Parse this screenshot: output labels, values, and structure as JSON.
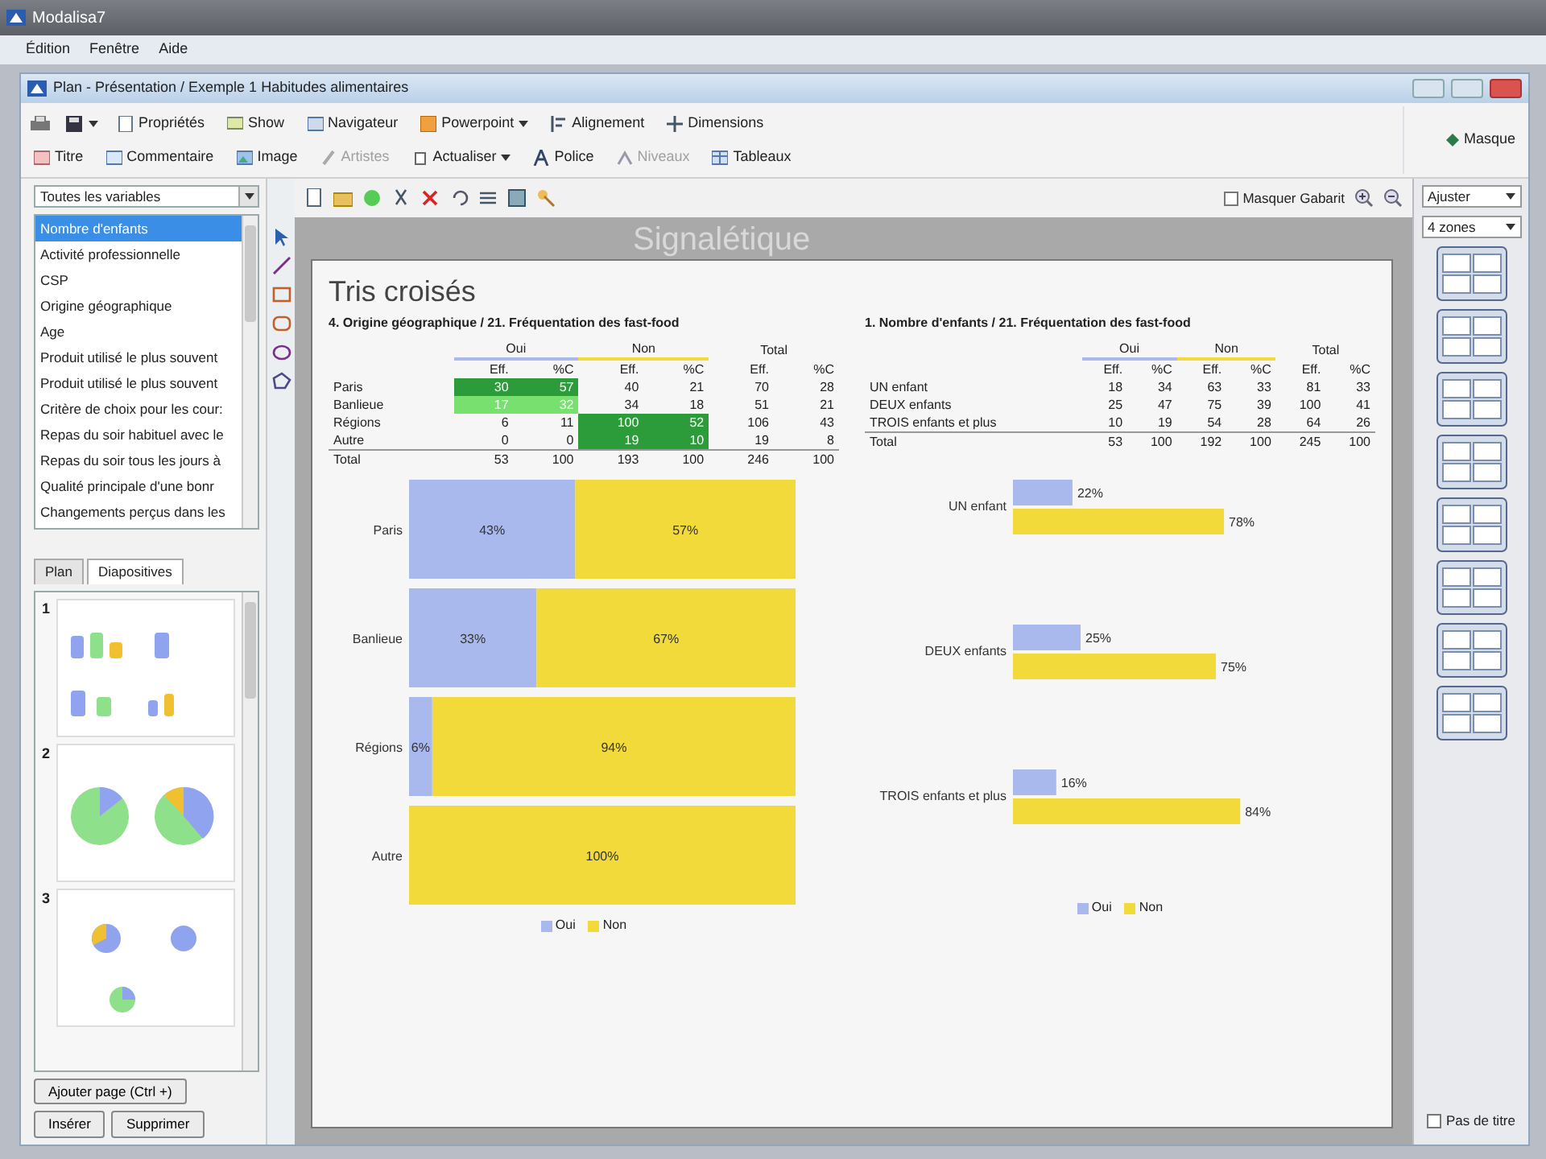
{
  "app": {
    "title": "Modalisa7"
  },
  "menu": [
    "Édition",
    "Fenêtre",
    "Aide"
  ],
  "window": {
    "title": "Plan - Présentation / Exemple 1 Habitudes alimentaires"
  },
  "ribbon": {
    "row_1": [
      {
        "label": "Propriétés",
        "dropdown": false,
        "disabled": false
      },
      {
        "label": "Show",
        "dropdown": false,
        "disabled": false
      },
      {
        "label": "Navigateur",
        "dropdown": false,
        "disabled": false
      },
      {
        "label": "Powerpoint",
        "dropdown": true,
        "disabled": false
      },
      {
        "label": "Alignement",
        "dropdown": false,
        "disabled": false
      },
      {
        "label": "Dimensions",
        "dropdown": false,
        "disabled": false
      }
    ],
    "row_2": [
      {
        "label": "Titre",
        "dropdown": false,
        "disabled": false
      },
      {
        "label": "Commentaire",
        "dropdown": false,
        "disabled": false
      },
      {
        "label": "Image",
        "dropdown": false,
        "disabled": false
      },
      {
        "label": "Artistes",
        "dropdown": false,
        "disabled": true
      },
      {
        "label": "Actualiser",
        "dropdown": true,
        "disabled": false
      },
      {
        "label": "Police",
        "dropdown": false,
        "disabled": false
      },
      {
        "label": "Niveaux",
        "dropdown": false,
        "disabled": true
      },
      {
        "label": "Tableaux",
        "dropdown": false,
        "disabled": false
      }
    ],
    "mask": "Masque"
  },
  "sidebar": {
    "filter": "Toutes les variables",
    "variables": [
      {
        "label": "Nombre d'enfants",
        "selected": true
      },
      {
        "label": "Activité professionnelle",
        "selected": false
      },
      {
        "label": "CSP",
        "selected": false
      },
      {
        "label": "Origine géographique",
        "selected": false
      },
      {
        "label": "Age",
        "selected": false
      },
      {
        "label": "Produit utilisé le plus souvent",
        "selected": false
      },
      {
        "label": "Produit utilisé le plus souvent",
        "selected": false
      },
      {
        "label": "Critère de choix pour les cour:",
        "selected": false
      },
      {
        "label": "Repas du soir habituel avec le",
        "selected": false
      },
      {
        "label": "Repas du soir tous les jours à",
        "selected": false
      },
      {
        "label": "Qualité principale d'une bonr",
        "selected": false
      },
      {
        "label": "Changements perçus dans les",
        "selected": false
      }
    ],
    "tabs": [
      {
        "label": "Plan",
        "selected": false
      },
      {
        "label": "Diapositives",
        "selected": true
      }
    ],
    "slides": [
      "1",
      "2",
      "3"
    ],
    "buttons": [
      "Ajouter page (Ctrl +)",
      "Insérer",
      "Supprimer"
    ]
  },
  "editor": {
    "hide_template": {
      "label": "Masquer Gabarit",
      "checked": false
    },
    "zoom": "Ajuster",
    "layout": "4 zones",
    "ghost_title": "Signalétique",
    "no_title": {
      "label": "Pas de titre",
      "checked": false
    }
  },
  "slide": {
    "title": "Tris croisés",
    "panels": [
      {
        "table": {
          "title": "4. Origine géographique / 21. Fréquentation des fast-food",
          "groups": [
            "Oui",
            "Non",
            "Total"
          ],
          "subcolumns": [
            "Eff.",
            "%C",
            "Eff.",
            "%C",
            "Eff.",
            "%C"
          ],
          "rows": [
            {
              "label": "Paris",
              "cells": [
                {
                  "text": "30",
                  "color": "#2c9c3a"
                },
                {
                  "text": "57",
                  "color": "#2c9c3a"
                },
                {
                  "text": "40"
                },
                {
                  "text": "21"
                },
                {
                  "text": "70"
                },
                {
                  "text": "28"
                }
              ]
            },
            {
              "label": "Banlieue",
              "cells": [
                {
                  "text": "17",
                  "color": "#78e06e"
                },
                {
                  "text": "32",
                  "color": "#78e06e"
                },
                {
                  "text": "34"
                },
                {
                  "text": "18"
                },
                {
                  "text": "51"
                },
                {
                  "text": "21"
                }
              ]
            },
            {
              "label": "Régions",
              "cells": [
                {
                  "text": "6"
                },
                {
                  "text": "11"
                },
                {
                  "text": "100",
                  "color": "#2c9c3a"
                },
                {
                  "text": "52",
                  "color": "#2c9c3a"
                },
                {
                  "text": "106"
                },
                {
                  "text": "43"
                }
              ]
            },
            {
              "label": "Autre",
              "cells": [
                {
                  "text": "0"
                },
                {
                  "text": "0"
                },
                {
                  "text": "19",
                  "color": "#2c9c3a"
                },
                {
                  "text": "10",
                  "color": "#2c9c3a"
                },
                {
                  "text": "19"
                },
                {
                  "text": "8"
                }
              ]
            },
            {
              "label": "Total",
              "cells": [
                {
                  "text": "53"
                },
                {
                  "text": "100"
                },
                {
                  "text": "193"
                },
                {
                  "text": "100"
                },
                {
                  "text": "246"
                },
                {
                  "text": "100"
                }
              ]
            }
          ]
        },
        "chart_data": {
          "type": "bar",
          "orientation": "horizontal",
          "stacked": true,
          "categories": [
            "Paris",
            "Banlieue",
            "Régions",
            "Autre"
          ],
          "series": [
            {
              "name": "Oui",
              "color": "#a9b9ee",
              "values": [
                43,
                33,
                6,
                0
              ],
              "value_labels": [
                "43%",
                "33%",
                "6%",
                null
              ]
            },
            {
              "name": "Non",
              "color": "#f2da3a",
              "values": [
                57,
                67,
                94,
                100
              ],
              "value_labels": [
                "57%",
                "67%",
                "94%",
                "100%"
              ]
            }
          ],
          "data_labels": true
        }
      },
      {
        "table": {
          "title": "1. Nombre d'enfants / 21. Fréquentation des fast-food",
          "groups": [
            "Oui",
            "Non",
            "Total"
          ],
          "subcolumns": [
            "Eff.",
            "%C",
            "Eff.",
            "%C",
            "Eff.",
            "%C"
          ],
          "rows": [
            {
              "label": "UN enfant",
              "cells": [
                {
                  "text": "18"
                },
                {
                  "text": "34"
                },
                {
                  "text": "63"
                },
                {
                  "text": "33"
                },
                {
                  "text": "81"
                },
                {
                  "text": "33"
                }
              ]
            },
            {
              "label": "DEUX enfants",
              "cells": [
                {
                  "text": "25"
                },
                {
                  "text": "47"
                },
                {
                  "text": "75"
                },
                {
                  "text": "39"
                },
                {
                  "text": "100"
                },
                {
                  "text": "41"
                }
              ]
            },
            {
              "label": "TROIS enfants et plus",
              "cells": [
                {
                  "text": "10"
                },
                {
                  "text": "19"
                },
                {
                  "text": "54"
                },
                {
                  "text": "28"
                },
                {
                  "text": "64"
                },
                {
                  "text": "26"
                }
              ]
            },
            {
              "label": "Total",
              "cells": [
                {
                  "text": "53"
                },
                {
                  "text": "100"
                },
                {
                  "text": "192"
                },
                {
                  "text": "100"
                },
                {
                  "text": "245"
                },
                {
                  "text": "100"
                }
              ]
            }
          ]
        },
        "chart_data": {
          "type": "bar",
          "orientation": "horizontal",
          "stacked": false,
          "categories": [
            "UN enfant",
            "DEUX enfants",
            "TROIS enfants et plus"
          ],
          "series": [
            {
              "name": "Oui",
              "color": "#a9b9ee",
              "values": [
                22,
                25,
                16
              ],
              "value_labels": [
                "22%",
                "25%",
                "16%"
              ]
            },
            {
              "name": "Non",
              "color": "#f2da3a",
              "values": [
                78,
                75,
                84
              ],
              "value_labels": [
                "78%",
                "75%",
                "84%"
              ]
            }
          ],
          "data_labels": true
        }
      }
    ]
  }
}
